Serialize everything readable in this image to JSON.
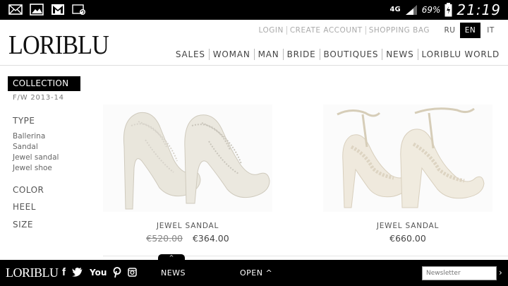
{
  "status_bar": {
    "network": "4G",
    "battery_percent": "69%",
    "time": "21:19"
  },
  "header": {
    "logo": "LORIBLU",
    "top_links": [
      "LOGIN",
      "CREATE ACCOUNT",
      "SHOPPING BAG"
    ],
    "languages": [
      "RU",
      "EN",
      "IT"
    ],
    "active_language": "EN",
    "nav": [
      "SALES",
      "WOMAN",
      "MAN",
      "BRIDE",
      "BOUTIQUES",
      "NEWS",
      "LORIBLU WORLD"
    ]
  },
  "sidebar": {
    "collection_label": "COLLECTION",
    "season": "F/W 2013-14",
    "type_heading": "TYPE",
    "types": [
      "Ballerina",
      "Sandal",
      "Jewel sandal",
      "Jewel shoe"
    ],
    "color_heading": "COLOR",
    "heel_heading": "HEEL",
    "size_heading": "SIZE"
  },
  "products": [
    {
      "name": "JEWEL SANDAL",
      "old_price": "€520.00",
      "price": "€364.00"
    },
    {
      "name": "JEWEL SANDAL",
      "price": "€660.00"
    }
  ],
  "bottom_bar": {
    "logo": "LORIBLU",
    "news_label": "NEWS",
    "open_label": "OPEN ^",
    "social": {
      "facebook": "f",
      "youtube": "You"
    },
    "newsletter_placeholder": "Newsletter",
    "submit": "›",
    "tab_arrow": "^"
  },
  "colors": {
    "bar": "#000000",
    "accent": "#000000",
    "text": "#444444"
  }
}
